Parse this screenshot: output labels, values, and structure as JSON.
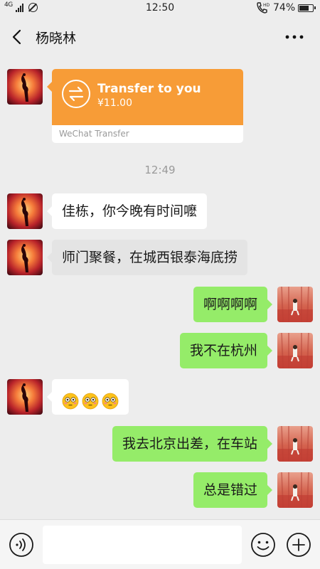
{
  "status_bar": {
    "network": "4G",
    "time": "12:50",
    "battery_pct": "74%",
    "battery_level": 0.74
  },
  "header": {
    "title": "杨晓林",
    "back_icon": "chevron-left-icon",
    "more_icon": "more-dots-icon"
  },
  "transfer": {
    "title": "Transfer to you",
    "amount": "¥11.00",
    "footer": "WeChat Transfer",
    "color": "#f79c37"
  },
  "timestamp": "12:49",
  "messages": [
    {
      "side": "in",
      "text": "佳栋，你今晚有时间嚒"
    },
    {
      "side": "in",
      "text": "师门聚餐，在城西银泰海底捞"
    },
    {
      "side": "out",
      "text": "啊啊啊啊"
    },
    {
      "side": "out",
      "text": "我不在杭州"
    },
    {
      "side": "in",
      "emoji": [
        "flushed-face-icon",
        "flushed-face-icon",
        "flushed-face-icon"
      ]
    },
    {
      "side": "out",
      "text": "我去北京出差，在车站"
    },
    {
      "side": "out",
      "text": "总是错过"
    }
  ],
  "colors": {
    "background": "#ededed",
    "outgoing_bubble": "#95ec69",
    "incoming_bubble": "#ffffff"
  },
  "input_bar": {
    "placeholder": "",
    "voice_icon": "voice-icon",
    "emoji_icon": "emoji-icon",
    "plus_icon": "plus-icon"
  }
}
